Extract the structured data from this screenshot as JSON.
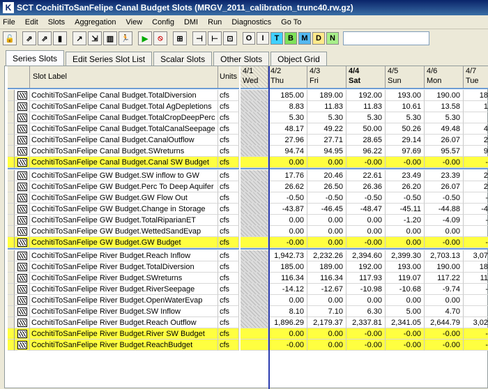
{
  "window": {
    "title": "SCT CochitiToSanFelipe Canal Budget Slots (MRGV_2011_calibration_trunc40.rw.gz)"
  },
  "menu": [
    "File",
    "Edit",
    "Slots",
    "Aggregation",
    "View",
    "Config",
    "DMI",
    "Run",
    "Diagnostics",
    "Go To"
  ],
  "toolbar": {
    "icons": [
      "lock-icon",
      "arrow-link-icon",
      "arrow-link2-icon",
      "column-icon",
      "arrow-out-icon",
      "arrow-x-icon",
      "chart-icon",
      "runner-icon",
      "play-icon",
      "stop-icon",
      "grid-icon",
      "col-left-icon",
      "col-right-icon",
      "col-fit-icon"
    ],
    "letters": [
      "O",
      "I",
      "T",
      "B",
      "M",
      "D",
      "N"
    ],
    "search_value": ""
  },
  "tabs": [
    "Series Slots",
    "Edit Series Slot List",
    "Scalar Slots",
    "Other Slots",
    "Object Grid"
  ],
  "table": {
    "label_header": "Slot Label",
    "units_header": "Units",
    "columns": [
      {
        "date": "4/1",
        "day": "Wed",
        "hatched": true,
        "bold": false
      },
      {
        "date": "4/2",
        "day": "Thu",
        "hatched": false,
        "bold": false
      },
      {
        "date": "4/3",
        "day": "Fri",
        "hatched": false,
        "bold": false
      },
      {
        "date": "4/4",
        "day": "Sat",
        "hatched": false,
        "bold": true
      },
      {
        "date": "4/5",
        "day": "Sun",
        "hatched": false,
        "bold": false
      },
      {
        "date": "4/6",
        "day": "Mon",
        "hatched": false,
        "bold": false
      },
      {
        "date": "4/7",
        "day": "Tue",
        "hatched": false,
        "bold": false
      }
    ],
    "groups": [
      {
        "rows": [
          {
            "label": "CochitiToSanFelipe Canal Budget.TotalDiversion",
            "units": "cfs",
            "values": [
              "185.00",
              "189.00",
              "192.00",
              "193.00",
              "190.00",
              "18"
            ],
            "highlight": false
          },
          {
            "label": "CochitiToSanFelipe Canal Budget.Total AgDepletions",
            "units": "cfs",
            "values": [
              "8.83",
              "11.83",
              "11.83",
              "10.61",
              "13.58",
              "1"
            ],
            "highlight": false
          },
          {
            "label": "CochitiToSanFelipe Canal Budget.TotalCropDeepPerc",
            "units": "cfs",
            "values": [
              "5.30",
              "5.30",
              "5.30",
              "5.30",
              "5.30",
              ""
            ],
            "highlight": false
          },
          {
            "label": "CochitiToSanFelipe Canal Budget.TotalCanalSeepage",
            "units": "cfs",
            "values": [
              "48.17",
              "49.22",
              "50.00",
              "50.26",
              "49.48",
              "4"
            ],
            "highlight": false
          },
          {
            "label": "CochitiToSanFelipe Canal Budget.CanalOutflow",
            "units": "cfs",
            "values": [
              "27.96",
              "27.71",
              "28.65",
              "29.14",
              "26.07",
              "2"
            ],
            "highlight": false
          },
          {
            "label": "CochitiToSanFelipe Canal Budget.SWreturns",
            "units": "cfs",
            "values": [
              "94.74",
              "94.95",
              "96.22",
              "97.69",
              "95.57",
              "9"
            ],
            "highlight": false
          },
          {
            "label": "CochitiToSanFelipe Canal Budget.Canal SW Budget",
            "units": "cfs",
            "values": [
              "0.00",
              "0.00",
              "-0.00",
              "-0.00",
              "-0.00",
              "-"
            ],
            "highlight": true
          }
        ]
      },
      {
        "rows": [
          {
            "label": "CochitiToSanFelipe GW Budget.SW inflow to GW",
            "units": "cfs",
            "values": [
              "17.76",
              "20.46",
              "22.61",
              "23.49",
              "23.39",
              "2"
            ],
            "highlight": false
          },
          {
            "label": "CochitiToSanFelipe GW Budget.Perc To Deep Aquifer",
            "units": "cfs",
            "values": [
              "26.62",
              "26.50",
              "26.36",
              "26.20",
              "26.07",
              "2"
            ],
            "highlight": false
          },
          {
            "label": "CochitiToSanFelipe GW Budget.GW Flow Out",
            "units": "cfs",
            "values": [
              "-0.50",
              "-0.50",
              "-0.50",
              "-0.50",
              "-0.50",
              "-"
            ],
            "highlight": false
          },
          {
            "label": "CochitiToSanFelipe GW Budget.Change in Storage",
            "units": "cfs",
            "values": [
              "-43.87",
              "-46.45",
              "-48.47",
              "-45.11",
              "-44.88",
              "-4"
            ],
            "highlight": false
          },
          {
            "label": "CochitiToSanFelipe GW Budget.TotalRiparianET",
            "units": "cfs",
            "values": [
              "0.00",
              "0.00",
              "0.00",
              "-1.20",
              "-4.09",
              "-"
            ],
            "highlight": false
          },
          {
            "label": "CochitiToSanFelipe GW Budget.WettedSandEvap",
            "units": "cfs",
            "values": [
              "0.00",
              "0.00",
              "0.00",
              "0.00",
              "0.00",
              ""
            ],
            "highlight": false
          },
          {
            "label": "CochitiToSanFelipe GW Budget.GW Budget",
            "units": "cfs",
            "values": [
              "-0.00",
              "0.00",
              "-0.00",
              "0.00",
              "-0.00",
              "-"
            ],
            "highlight": true
          }
        ]
      },
      {
        "rows": [
          {
            "label": "CochitiToSanFelipe River Budget.Reach Inflow",
            "units": "cfs",
            "values": [
              "1,942.73",
              "2,232.26",
              "2,394.60",
              "2,399.30",
              "2,703.13",
              "3,07"
            ],
            "highlight": false
          },
          {
            "label": "CochitiToSanFelipe River Budget.TotalDiversion",
            "units": "cfs",
            "values": [
              "185.00",
              "189.00",
              "192.00",
              "193.00",
              "190.00",
              "18"
            ],
            "highlight": false
          },
          {
            "label": "CochitiToSanFelipe River Budget.SWreturns",
            "units": "cfs",
            "values": [
              "116.34",
              "116.34",
              "117.93",
              "119.07",
              "117.22",
              "11"
            ],
            "highlight": false
          },
          {
            "label": "CochitiToSanFelipe River Budget.RiverSeepage",
            "units": "cfs",
            "values": [
              "-14.12",
              "-12.67",
              "-10.98",
              "-10.68",
              "-9.74",
              "-"
            ],
            "highlight": false
          },
          {
            "label": "CochitiToSanFelipe River Budget.OpenWaterEvap",
            "units": "cfs",
            "values": [
              "0.00",
              "0.00",
              "0.00",
              "0.00",
              "0.00",
              ""
            ],
            "highlight": false
          },
          {
            "label": "CochitiToSanFelipe River Budget.SW Inflow",
            "units": "cfs",
            "values": [
              "8.10",
              "7.10",
              "6.30",
              "5.00",
              "4.70",
              ""
            ],
            "highlight": false
          },
          {
            "label": "CochitiToSanFelipe River Budget.Reach Outflow",
            "units": "cfs",
            "values": [
              "1,896.29",
              "2,179.37",
              "2,337.81",
              "2,341.05",
              "2,644.79",
              "3,02"
            ],
            "highlight": false
          },
          {
            "label": "CochitiToSanFelipe River Budget.River SW Budget",
            "units": "cfs",
            "values": [
              "0.00",
              "0.00",
              "-0.00",
              "-0.00",
              "-0.00",
              "-"
            ],
            "highlight": true
          },
          {
            "label": "CochitiToSanFelipe River Budget.ReachBudget",
            "units": "cfs",
            "values": [
              "-0.00",
              "0.00",
              "-0.00",
              "-0.00",
              "-0.00",
              "-"
            ],
            "highlight": true
          }
        ]
      }
    ]
  }
}
